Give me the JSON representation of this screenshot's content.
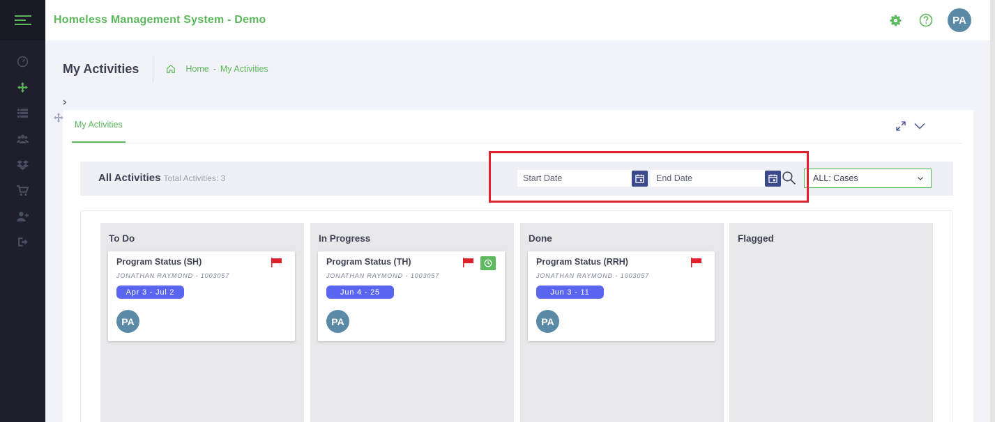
{
  "header": {
    "title": "Homeless Management System - Demo",
    "user_initials": "PA"
  },
  "subheader": {
    "page_title": "My Activities",
    "breadcrumb": [
      "Home",
      "My Activities"
    ]
  },
  "card": {
    "tab_label": "My Activities"
  },
  "filters": {
    "title": "All Activities",
    "total_label": "Total Activities: 3",
    "start_date_placeholder": "Start Date",
    "end_date_placeholder": "End Date",
    "case_select": "ALL: Cases"
  },
  "colors": {
    "brand_green": "#5cb85c",
    "sidebar": "#1e1e2d",
    "date_pill": "#5a66f0",
    "flag_red": "#e0202a",
    "avatar": "#5b8aa6"
  },
  "board": {
    "columns": [
      {
        "title": "To Do",
        "tasks": [
          {
            "title": "Program Status (SH)",
            "client": "JONATHAN RAYMOND - 1003057",
            "dates": "Apr 3 - Jul 2",
            "assignee": "PA",
            "flag_icon": "flag-icon"
          }
        ]
      },
      {
        "title": "In Progress",
        "tasks": [
          {
            "title": "Program Status (TH)",
            "client": "JONATHAN RAYMOND - 1003057",
            "dates": "Jun 4 - 25",
            "assignee": "PA",
            "flag_icon": "flag-icon",
            "status_icon": "clock-icon"
          }
        ]
      },
      {
        "title": "Done",
        "tasks": [
          {
            "title": "Program Status (RRH)",
            "client": "JONATHAN RAYMOND - 1003057",
            "dates": "Jun 3 - 11",
            "assignee": "PA",
            "flag_icon": "flag-icon"
          }
        ]
      },
      {
        "title": "Flagged",
        "tasks": []
      }
    ]
  }
}
